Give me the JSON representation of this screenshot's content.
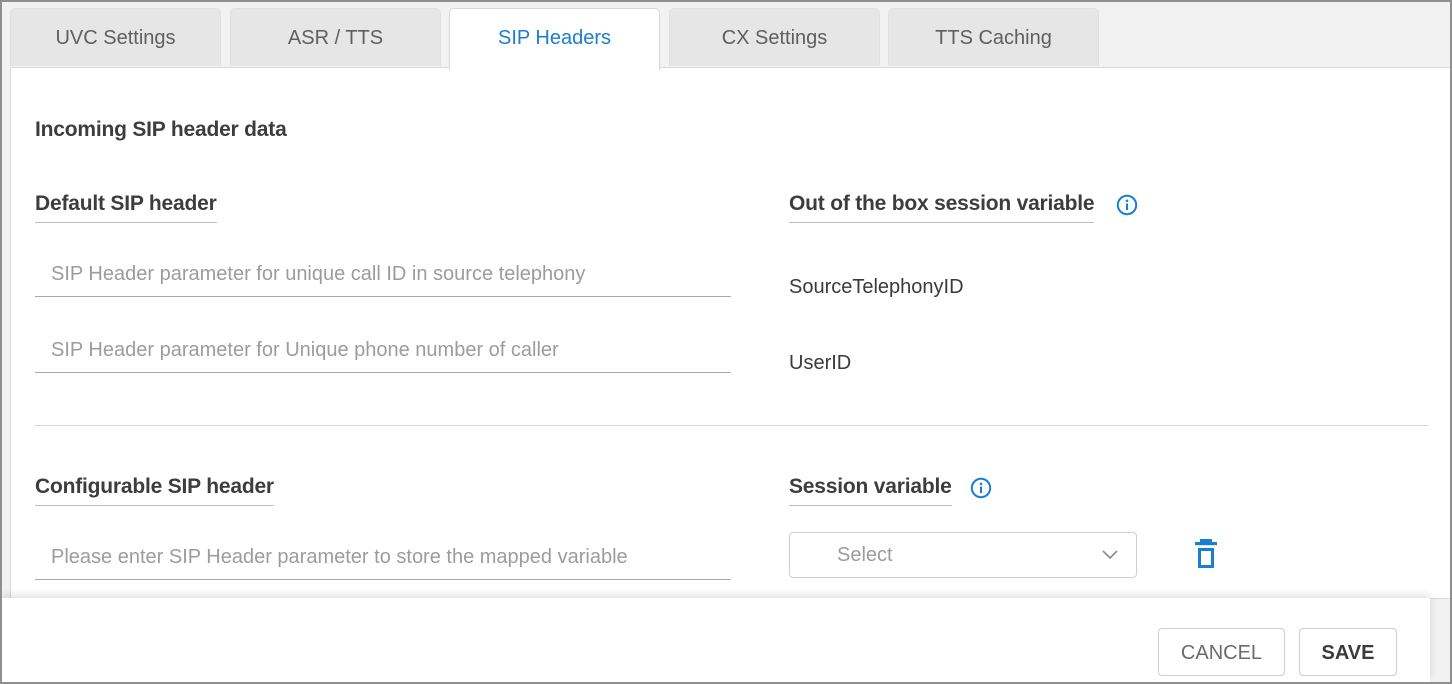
{
  "tabs": [
    {
      "label": "UVC Settings",
      "active": false
    },
    {
      "label": "ASR / TTS",
      "active": false
    },
    {
      "label": "SIP Headers",
      "active": true
    },
    {
      "label": "CX Settings",
      "active": false
    },
    {
      "label": "TTS Caching",
      "active": false
    }
  ],
  "section_title": "Incoming SIP header data",
  "default_header": {
    "column_title": "Default SIP header",
    "variable_column_title": "Out of the box session variable",
    "rows": [
      {
        "placeholder": "SIP Header parameter for unique call ID in source telephony",
        "variable": "SourceTelephonyID"
      },
      {
        "placeholder": "SIP Header parameter for Unique phone number of caller",
        "variable": "UserID"
      }
    ]
  },
  "configurable_header": {
    "column_title": "Configurable SIP header",
    "variable_column_title": "Session variable",
    "input_placeholder": "Please enter SIP Header parameter to store the mapped variable",
    "select_placeholder": "Select"
  },
  "footer": {
    "cancel_label": "CANCEL",
    "save_label": "SAVE"
  },
  "colors": {
    "accent": "#1a7fd0",
    "tab_inactive_bg": "#e6e6e6",
    "text_dark": "#3d3d3d",
    "placeholder": "#9c9c9c"
  },
  "icons": {
    "info": "info-circle-icon",
    "dropdown": "chevron-down-icon",
    "delete": "trash-icon"
  }
}
